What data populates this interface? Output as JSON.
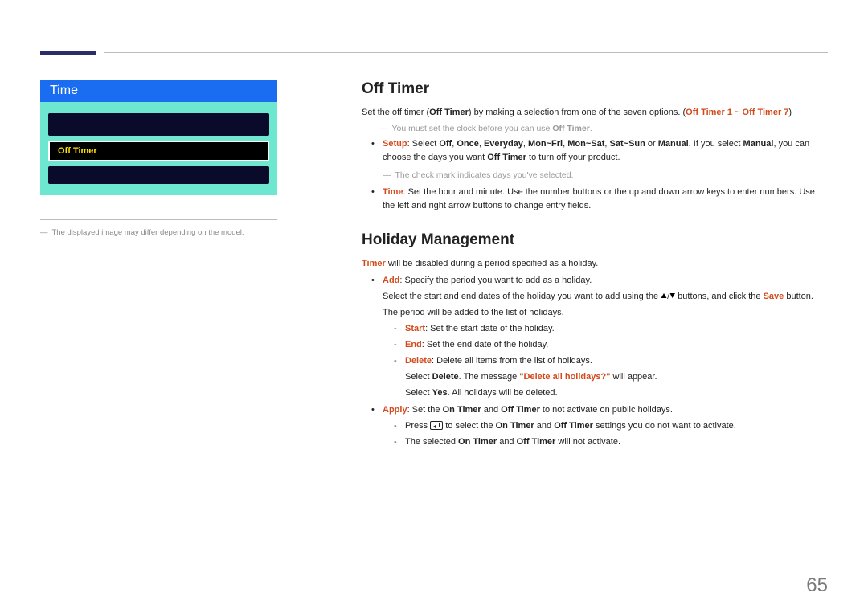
{
  "menu": {
    "header": "Time",
    "active_item": "Off Timer"
  },
  "left_caption": "The displayed image may differ depending on the model.",
  "off_timer": {
    "heading": "Off Timer",
    "intro_a": "Set the off timer (",
    "intro_b": "Off Timer",
    "intro_c": ") by making a selection from one of the seven options. (",
    "intro_d": "Off Timer 1 ~ Off Timer 7",
    "intro_e": ")",
    "note1_a": "You must set the clock before you can use ",
    "note1_b": "Off Timer",
    "note1_c": ".",
    "setup_label": "Setup",
    "setup_a": ": Select ",
    "setup_off": "Off",
    "setup_once": "Once",
    "setup_everyday": "Everyday",
    "setup_monfri": "Mon~Fri",
    "setup_monsat": "Mon~Sat",
    "setup_satsun": "Sat~Sun",
    "setup_or": " or ",
    "setup_manual": "Manual",
    "setup_b": ". If you select ",
    "setup_manual2": "Manual",
    "setup_c": ", you can choose the days you want ",
    "setup_offtimer": "Off Timer",
    "setup_d": " to turn off your product.",
    "note2": "The check mark indicates days you've selected.",
    "time_label": "Time",
    "time_text": ": Set the hour and minute. Use the number buttons or the up and down arrow keys to enter numbers. Use the left and right arrow buttons to change entry fields."
  },
  "holiday": {
    "heading": "Holiday Management",
    "intro_a": "Timer",
    "intro_b": " will be disabled during a period specified as a holiday.",
    "add_label": "Add",
    "add_text": ": Specify the period you want to add as a holiday.",
    "add_line2_a": "Select the start and end dates of the holiday you want to add using the ",
    "add_line2_b": " buttons, and click the ",
    "add_line2_save": "Save",
    "add_line2_c": " button.",
    "add_line3": "The period will be added to the list of holidays.",
    "start_label": "Start",
    "start_text": ": Set the start date of the holiday.",
    "end_label": "End",
    "end_text": ": Set the end date of the holiday.",
    "delete_label": "Delete",
    "delete_text": ": Delete all items from the list of holidays.",
    "delete_line2_a": "Select ",
    "delete_line2_b": "Delete",
    "delete_line2_c": ". The message ",
    "delete_line2_q": "\"Delete all holidays?\"",
    "delete_line2_d": " will appear.",
    "delete_line3_a": "Select ",
    "delete_line3_b": "Yes",
    "delete_line3_c": ". All holidays will be deleted.",
    "apply_label": "Apply",
    "apply_a": ": Set the ",
    "apply_on": "On Timer",
    "apply_and": " and ",
    "apply_off": "Off Timer",
    "apply_b": " to not activate on public holidays.",
    "apply_sub1_a": "Press ",
    "apply_sub1_b": " to select the ",
    "apply_sub1_on": "On Timer",
    "apply_sub1_and": " and ",
    "apply_sub1_off": "Off Timer",
    "apply_sub1_c": " settings you do not want to activate.",
    "apply_sub2_a": "The selected ",
    "apply_sub2_on": "On Timer",
    "apply_sub2_and": " and ",
    "apply_sub2_off": "Off Timer",
    "apply_sub2_b": " will not activate."
  },
  "page_number": "65",
  "sep": ", "
}
